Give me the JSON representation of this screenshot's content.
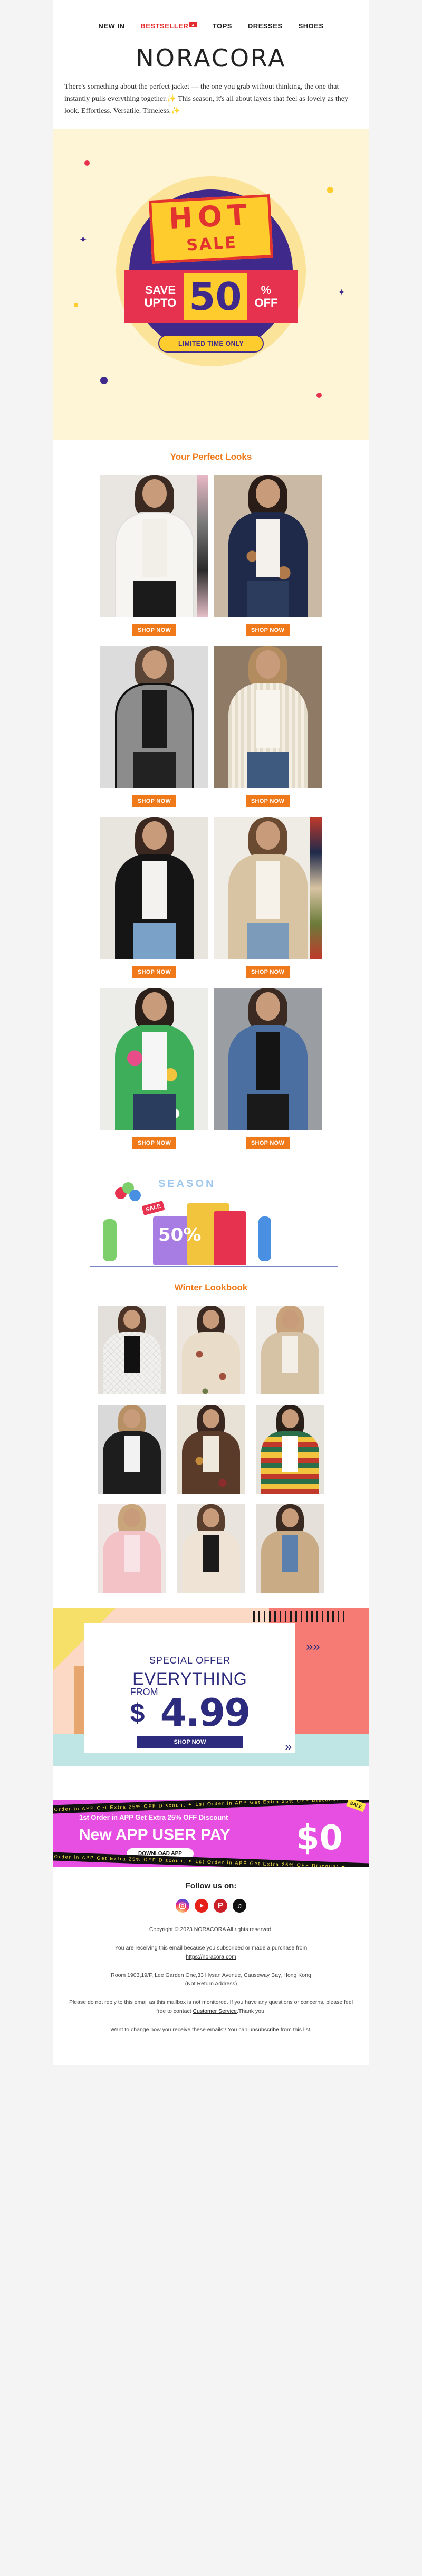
{
  "nav": {
    "items": [
      "NEW IN",
      "BESTSELLER",
      "TOPS",
      "DRESSES",
      "SHOES"
    ],
    "hot_badge": "",
    "active_color": "#e52b2b"
  },
  "brand": {
    "logo": "NORACORA"
  },
  "intro": "There's something about the perfect jacket — the one you grab without thinking, the one that instantly pulls everything together.✨ This season, it's all about layers that feel as lovely as they look. Effortless. Versatile. Timeless.✨",
  "hero": {
    "hot": "HOT",
    "sale": "SALE",
    "save_upto": [
      "SAVE",
      "UPTO"
    ],
    "percent": "50",
    "off": [
      "%",
      "OFF"
    ],
    "limited": "LIMITED TIME ONLY"
  },
  "perfect_looks": {
    "title": "Your Perfect Looks",
    "shop_label": "SHOP NOW",
    "products": [
      {
        "name": "white-jacket"
      },
      {
        "name": "navy-floral-jacket"
      },
      {
        "name": "grey-coat"
      },
      {
        "name": "cream-knit-coat"
      },
      {
        "name": "black-blazer"
      },
      {
        "name": "beige-blazer"
      },
      {
        "name": "floral-blazer"
      },
      {
        "name": "denim-coat"
      }
    ]
  },
  "promo50": {
    "season": "SEASON",
    "sale_tag": "SALE",
    "percent": "50%"
  },
  "lookbook": {
    "title": "Winter Lookbook"
  },
  "offer": {
    "special": "SPECIAL OFFER",
    "everything": "EVERYTHING",
    "from": "FROM",
    "dollar": "$",
    "price": "4.99",
    "button": "SHOP NOW"
  },
  "app_banner": {
    "stripe_text": "1st Order in APP Get Extra 25% OFF Discount  ✦  1st Order in APP Get Extra 25% OFF Discount  ✦  ",
    "line1": "1st Order in APP Get Extra 25% OFF Discount",
    "line2": "New APP USER PAY",
    "zero": "$0",
    "download": "DOWNLOAD APP",
    "sale_tag": "SALE"
  },
  "footer": {
    "follow": "Follow us on:",
    "socials": [
      "instagram-icon",
      "youtube-icon",
      "pinterest-icon",
      "tiktok-icon"
    ],
    "copyright": "Copyright © 2023 NORACORA All rights reserved.",
    "receiving_pre": "You are receiving this email because you subscribed or made a purchase from",
    "site_link": "https://noracora.com",
    "address": "Room 1903,19/F, Lee Garden One,33 Hysan Avenue, Causeway Bay, Hong Kong",
    "return_note": "(Not Return Address)",
    "do_not_reply_pre": "Please do not reply to this email as this mailbox is not monitored. If you have any questions or concerns, please feel free to contact",
    "customer_service": "Customer Service",
    "do_not_reply_post": ".Thank you.",
    "unsub_pre": "Want to change how you receive these emails? You can",
    "unsub_link": "unsubscribe",
    "unsub_post": "from this list."
  }
}
